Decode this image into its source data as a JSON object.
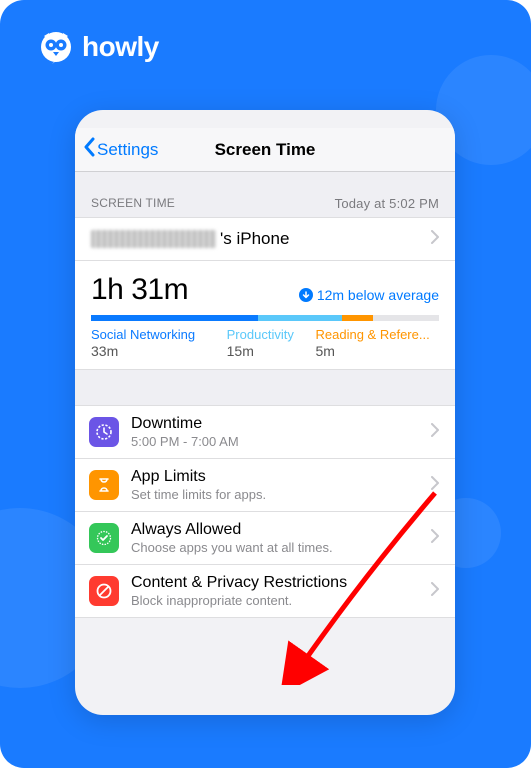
{
  "brand": {
    "name": "howly"
  },
  "nav": {
    "back_label": "Settings",
    "title": "Screen Time"
  },
  "section": {
    "label": "SCREEN TIME",
    "timestamp": "Today at 5:02 PM"
  },
  "device": {
    "suffix": "'s iPhone"
  },
  "summary": {
    "total": "1h 31m",
    "average_delta": "12m below average",
    "categories": [
      {
        "name": "Social Networking",
        "time": "33m"
      },
      {
        "name": "Productivity",
        "time": "15m"
      },
      {
        "name": "Reading & Refere...",
        "time": "5m"
      }
    ]
  },
  "options": {
    "downtime": {
      "title": "Downtime",
      "sub": "5:00 PM - 7:00 AM"
    },
    "applimits": {
      "title": "App Limits",
      "sub": "Set time limits for apps."
    },
    "always": {
      "title": "Always Allowed",
      "sub": "Choose apps you want at all times."
    },
    "content": {
      "title": "Content & Privacy Restrictions",
      "sub": "Block inappropriate content."
    }
  }
}
